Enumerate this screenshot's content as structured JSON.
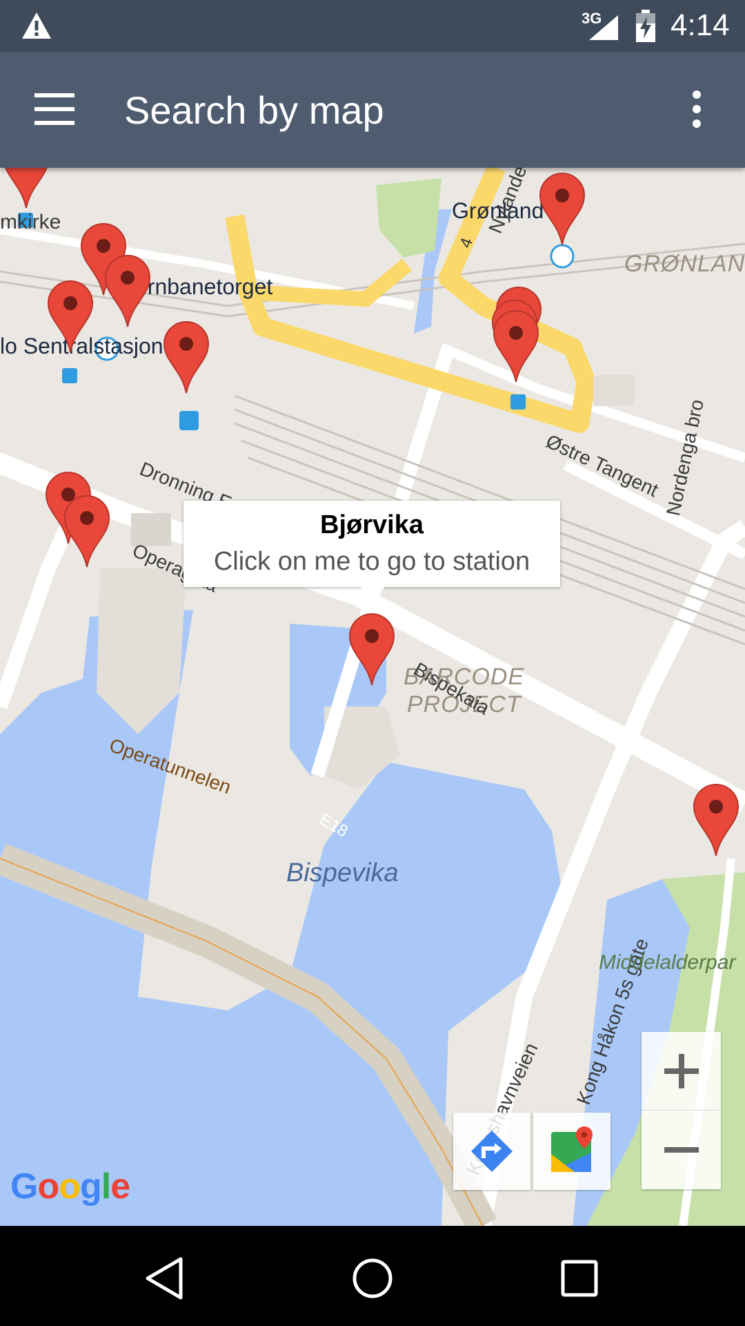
{
  "status_bar": {
    "network": "3G",
    "time": "4:14"
  },
  "app_bar": {
    "title": "Search by map"
  },
  "map": {
    "labels": {
      "gronland": "Grønland",
      "nylande": "Nylande",
      "gronland_area": "GRØNLAND",
      "domkirke": "mkirke",
      "jernbanetorget": "Jernbanetorget",
      "sentralstasjon": "lo Sentralstasjon",
      "ostre_tangent": "Østre Tangent",
      "nordenga_bro": "Nordenga bro",
      "dronning": "Dronning Eufemias gate",
      "operagata": "Operagata",
      "barcode": "BARCODE",
      "project": "PROJECT",
      "bispekaia": "Bispekaia",
      "operatunnelen": "Operatunnelen",
      "e18": "E18",
      "bispevika": "Bispevika",
      "kong_hakon": "Kong Håkon 5s gate",
      "koneshavnveien": "Koneshavnveien",
      "middelalderpark": "Middelalderpar",
      "route_4": "4"
    },
    "info_window": {
      "title": "Bjørvika",
      "subtitle": "Click on me to go to station"
    },
    "attribution": "Google",
    "colors": {
      "land": "#ebe8e3",
      "water": "#a9c8f8",
      "park": "#c6e0a8",
      "highway": "#fad86a",
      "pin": "#e8473a"
    }
  }
}
